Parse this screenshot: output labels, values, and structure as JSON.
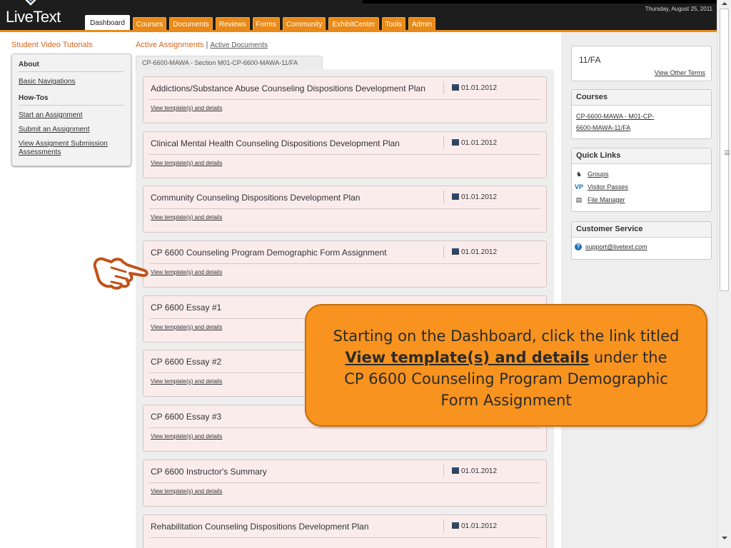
{
  "app": {
    "logo_text": "LiveText",
    "date_text": "Thursday, August 25, 2011"
  },
  "tabs": [
    {
      "label": "Dashboard",
      "active": true
    },
    {
      "label": "Courses"
    },
    {
      "label": "Documents"
    },
    {
      "label": "Reviews"
    },
    {
      "label": "Forms"
    },
    {
      "label": "Community"
    },
    {
      "label": "ExhibitCenter"
    },
    {
      "label": "Tools"
    },
    {
      "label": "Admin"
    }
  ],
  "left_sidebar": {
    "title": "Student Video Tutorials",
    "about_heading": "About",
    "about_links": [
      "Basic Navigations"
    ],
    "howtos_heading": "How-Tos",
    "howto_links": [
      "Start an Assignment",
      "Submit an Assignment",
      "View Assigment Submission Assessments"
    ]
  },
  "main": {
    "active_assignments_label": "Active Assignments",
    "separator": "|",
    "active_documents_label": "Active Documents",
    "section_tab_label": "CP-6600-MAWA - Section M01-CP-6600-MAWA-11/FA",
    "template_link_label": "View template(s) and details",
    "assignments": [
      {
        "name": "Addictions/Substance Abuse Counseling Dispositions Development Plan",
        "date": "01.01.2012"
      },
      {
        "name": "Clinical Mental Health Counseling Dispositions Development Plan",
        "date": "01.01.2012"
      },
      {
        "name": "Community Counseling Dispositions Development Plan",
        "date": "01.01.2012"
      },
      {
        "name": "CP 6600 Counseling Program Demographic Form Assignment",
        "date": "01.01.2012"
      },
      {
        "name": "CP 6600 Essay #1",
        "date": ""
      },
      {
        "name": "CP 6600 Essay #2",
        "date": ""
      },
      {
        "name": "CP 6600 Essay #3",
        "date": ""
      },
      {
        "name": "CP 6600 Instructor's Summary",
        "date": "01.01.2012"
      },
      {
        "name": "Rehabilitation Counseling Dispositions Development Plan",
        "date": "01.01.2012"
      }
    ]
  },
  "right_sidebar": {
    "term": "11/FA",
    "view_other_terms": "View Other Terms",
    "courses_title": "Courses",
    "course_link": "CP-6600-MAWA - M01-CP-6600-MAWA-11/FA",
    "quick_links_title": "Quick Links",
    "quick_links": [
      {
        "label": "Groups",
        "icon": "groups-icon"
      },
      {
        "label": "Visitor Passes",
        "icon": "visitor-pass-icon"
      },
      {
        "label": "File Manager",
        "icon": "file-manager-icon"
      }
    ],
    "customer_service_title": "Customer Service",
    "support_email": "support@livetext.com"
  },
  "callout": {
    "line1": "Starting on the Dashboard, click the link titled",
    "link_text": "View template(s) and details",
    "line2_tail": "under the",
    "line3": "CP 6600 Counseling Program Demographic",
    "line4": "Form Assignment"
  },
  "colors": {
    "accent_orange": "#e98a18",
    "callout_orange": "#f7931e",
    "header_dark": "#1d1d1d",
    "card_pink": "#fbecec"
  }
}
